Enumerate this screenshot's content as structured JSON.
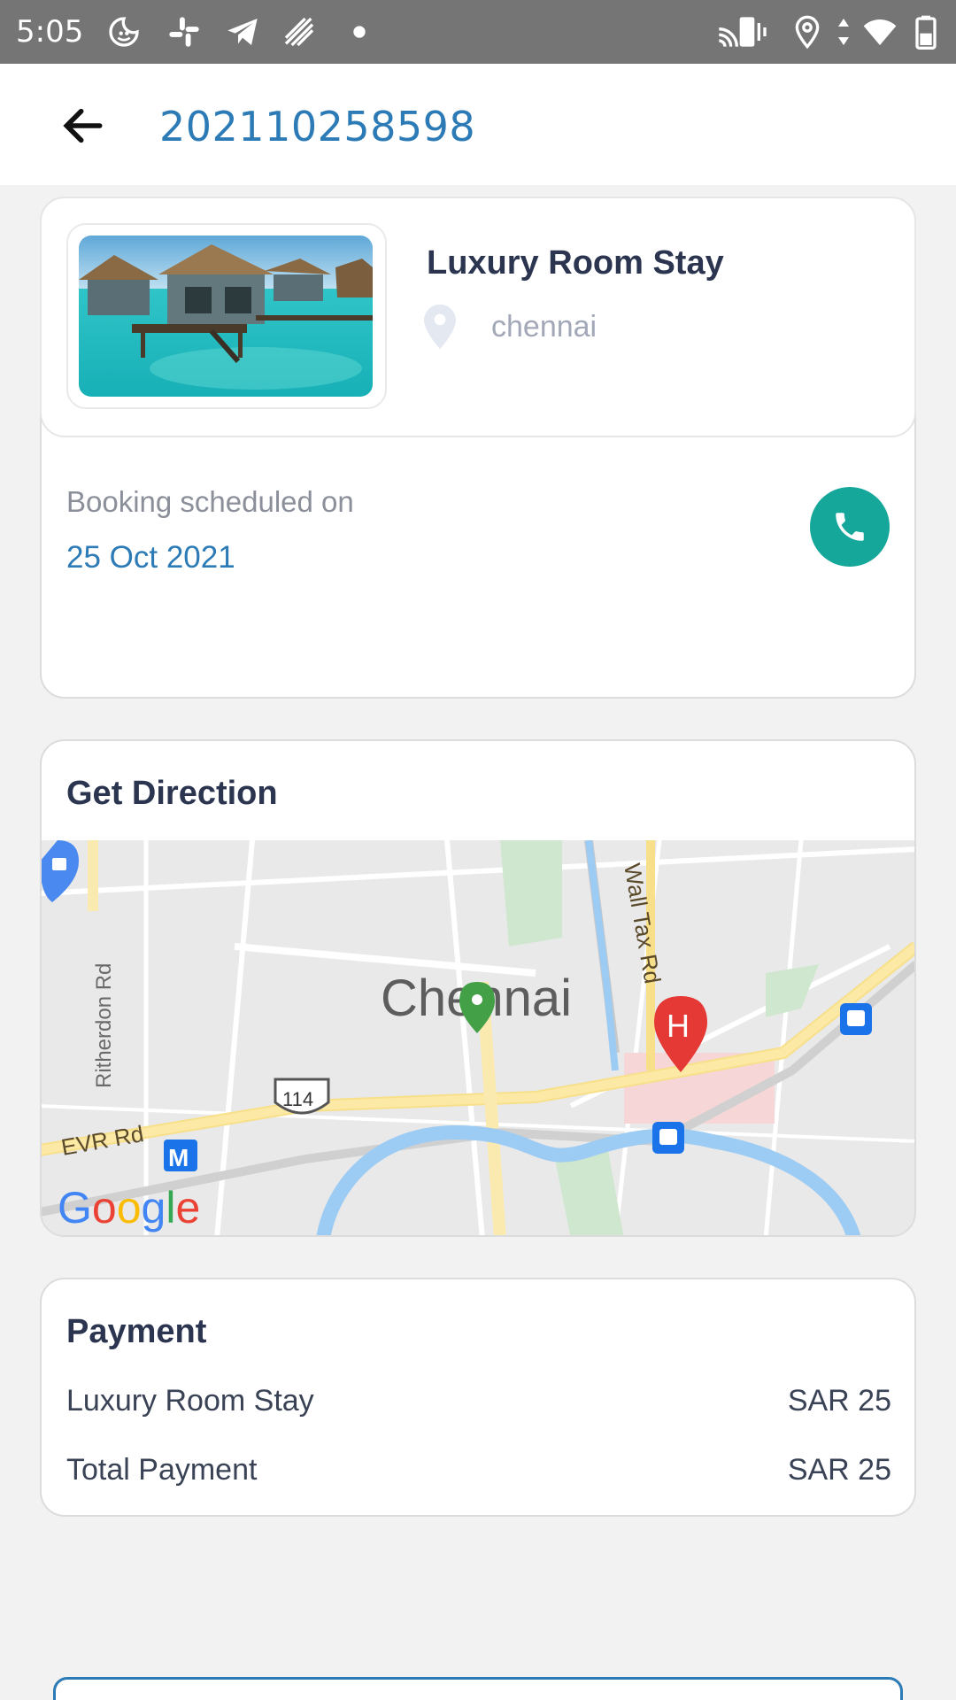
{
  "status_bar": {
    "time": "5:05",
    "left_icons": [
      "smiley-moon-icon",
      "slack-icon",
      "telegram-icon",
      "signal-stripes-icon",
      "dot-icon"
    ],
    "right_icons": [
      "cast-vibrate-icon",
      "location-icon",
      "data-arrows-icon",
      "wifi-icon",
      "battery-icon"
    ]
  },
  "header": {
    "back_icon": "arrow-left-icon",
    "title": "202110258598"
  },
  "booking": {
    "hotel_name": "Luxury Room Stay",
    "city": "chennai",
    "schedule_label": "Booking scheduled on",
    "schedule_date": "25 Oct 2021",
    "call_icon": "phone-icon"
  },
  "direction": {
    "title": "Get Direction",
    "map": {
      "city_label": "Chennai",
      "road_labels": [
        "Ritherdon Rd",
        "EVR Rd",
        "Wall Tax Rd"
      ],
      "shield_number": "114",
      "brand": "Google",
      "poi_icons": [
        "shopping-pin-icon",
        "hospital-pin-icon",
        "train-station-icon",
        "metro-icon",
        "destination-pin-icon"
      ]
    }
  },
  "payment": {
    "title": "Payment",
    "rows": [
      {
        "label": "Luxury Room Stay",
        "amount": "SAR 25"
      },
      {
        "label": "Total Payment",
        "amount": "SAR 25"
      }
    ]
  },
  "colors": {
    "accent": "#2c7bb6",
    "call_button": "#14a79a",
    "status_bar": "#757575"
  }
}
